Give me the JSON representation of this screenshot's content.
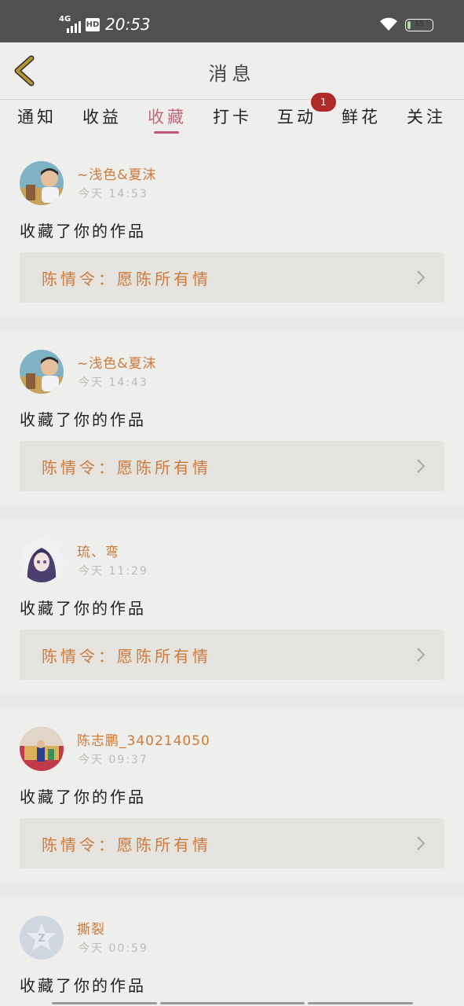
{
  "status_bar": {
    "network": "4G",
    "hd": "HD",
    "time": "20:53",
    "battery": "15",
    "battery_level": 0.15
  },
  "header": {
    "title": "消息"
  },
  "tabs": [
    {
      "label": "通知",
      "active": false
    },
    {
      "label": "收益",
      "active": false
    },
    {
      "label": "收藏",
      "active": true
    },
    {
      "label": "打卡",
      "active": false
    },
    {
      "label": "互动",
      "active": false,
      "badge": "1"
    },
    {
      "label": "鲜花",
      "active": false
    },
    {
      "label": "关注",
      "active": false
    }
  ],
  "items": [
    {
      "username": "~浅色&夏沫",
      "time": "今天 14:53",
      "action": "收藏了你的作品",
      "work": "陈情令：愿陈所有情",
      "avatar": "child-photo"
    },
    {
      "username": "~浅色&夏沫",
      "time": "今天 14:43",
      "action": "收藏了你的作品",
      "work": "陈情令：愿陈所有情",
      "avatar": "child-photo"
    },
    {
      "username": "琉、弯",
      "time": "今天 11:29",
      "action": "收藏了你的作品",
      "work": "陈情令：愿陈所有情",
      "avatar": "anime-girl"
    },
    {
      "username": "陈志鹏_340214050",
      "time": "今天 09:37",
      "action": "收藏了你的作品",
      "work": "陈情令：愿陈所有情",
      "avatar": "group-photo"
    },
    {
      "username": "撕裂",
      "time": "今天 00:59",
      "action": "收藏了你的作品",
      "avatar": "default-star"
    }
  ],
  "colors": {
    "accent": "#c05576",
    "username": "#cc7a3c",
    "badge": "#b02a2a",
    "back_arrow": "#b8962e"
  }
}
